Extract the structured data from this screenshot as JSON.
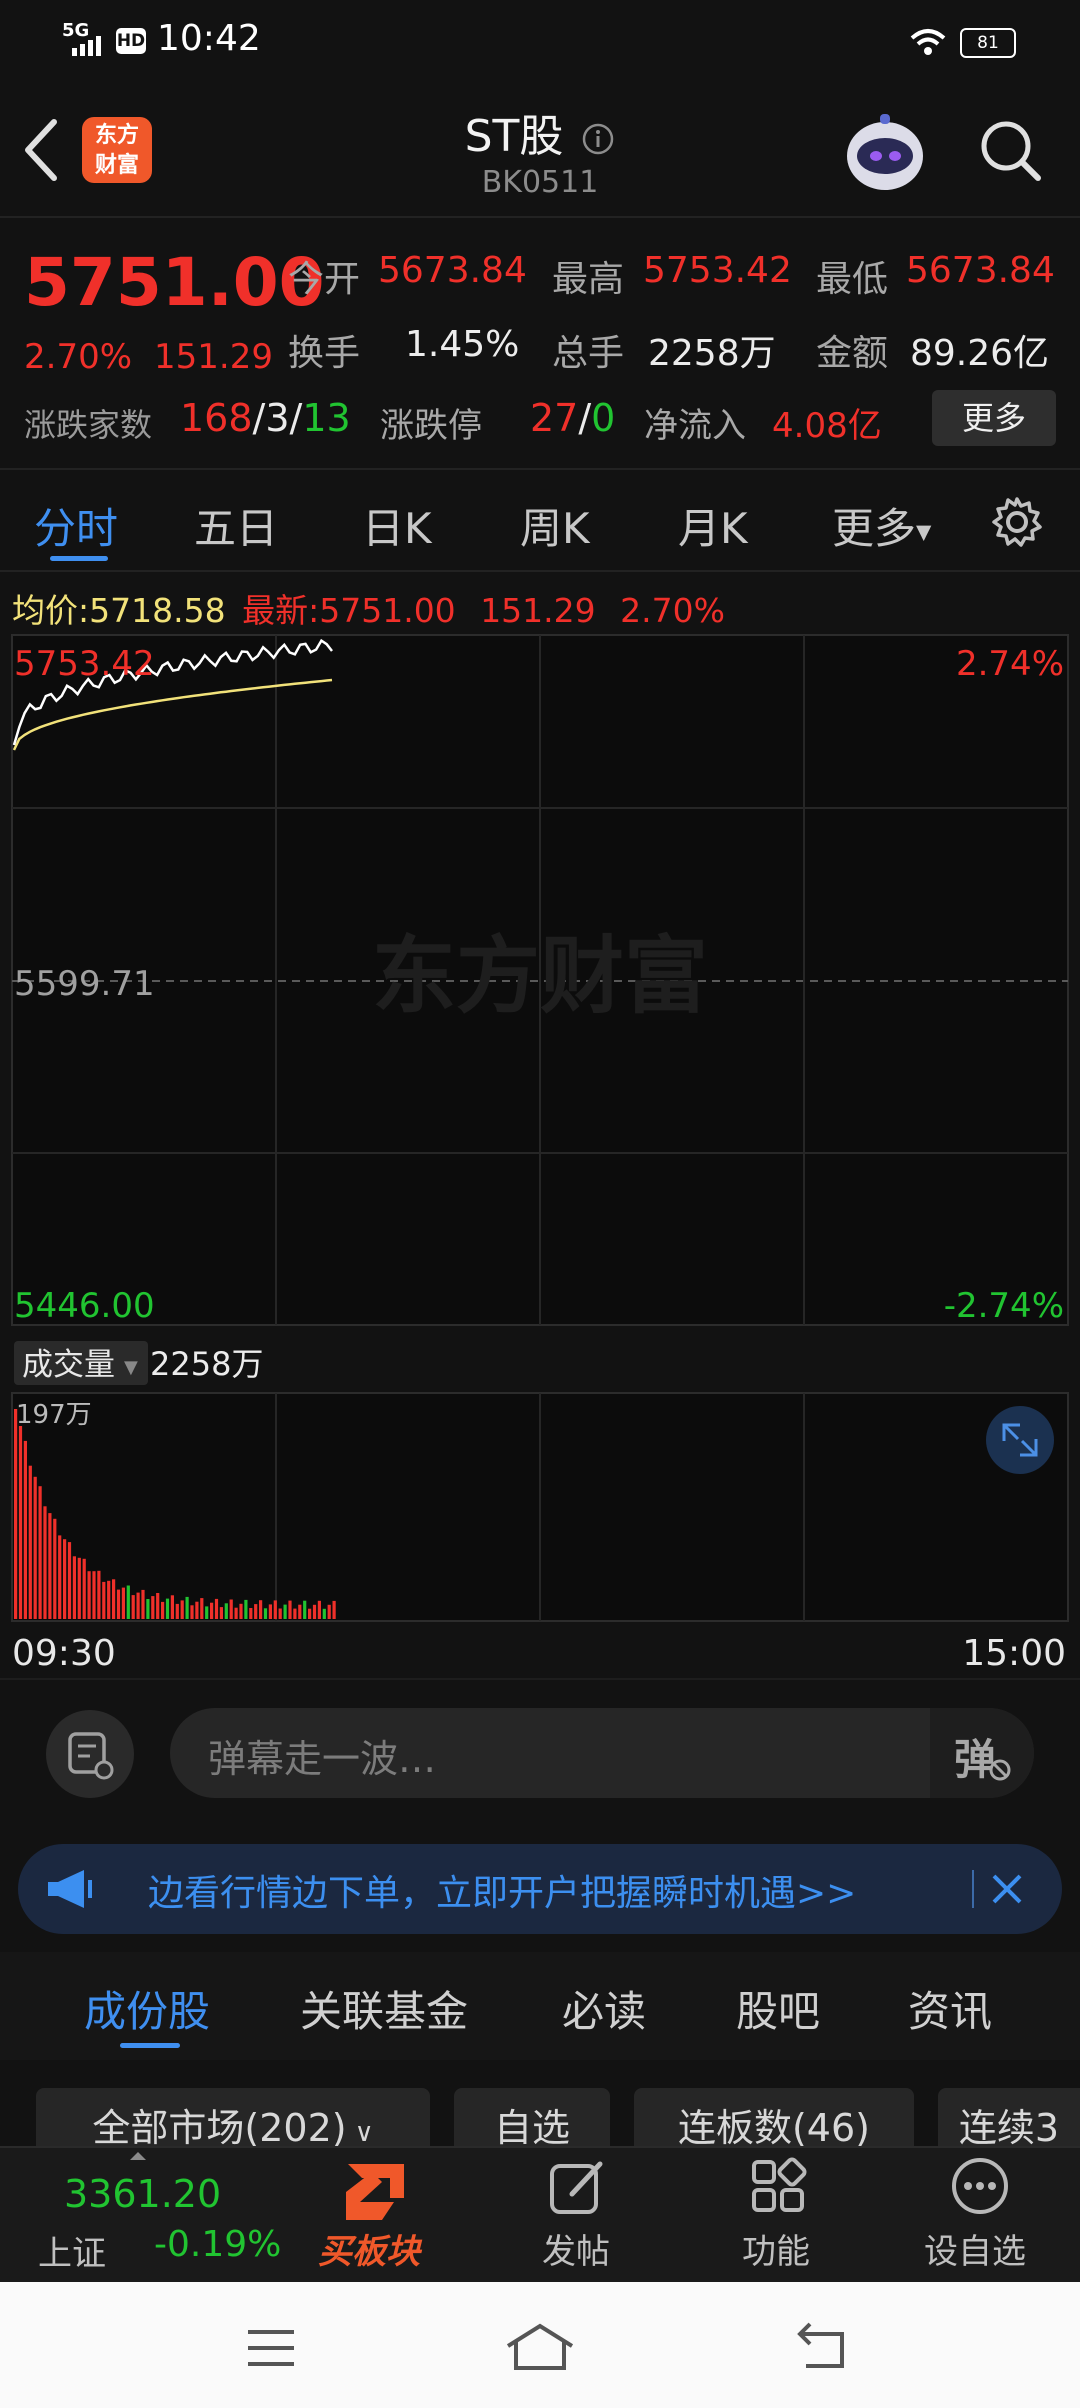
{
  "status": {
    "network": "5G",
    "hd": "HD",
    "time": "10:42",
    "battery": "81"
  },
  "header": {
    "title": "ST股",
    "code": "BK0511",
    "logo_line1": "东方",
    "logo_line2": "财富"
  },
  "quote": {
    "price": "5751.00",
    "change_pct": "2.70%",
    "change_val": "151.29",
    "open_label": "今开",
    "open": "5673.84",
    "high_label": "最高",
    "high": "5753.42",
    "low_label": "最低",
    "low": "5673.84",
    "turnover_label": "换手",
    "turnover": "1.45%",
    "volume_label": "总手",
    "volume": "2258万",
    "amount_label": "金额",
    "amount": "89.26亿",
    "breadth_label": "涨跌家数",
    "breadth_up": "168",
    "breadth_sep1": "/",
    "breadth_flat": "3",
    "breadth_sep2": "/",
    "breadth_down": "13",
    "limit_label": "涨跌停",
    "limit_up": "27",
    "limit_sep": "/",
    "limit_down": "0",
    "netflow_label": "净流入",
    "netflow": "4.08亿",
    "more_button": "更多"
  },
  "chart_tabs": [
    "分时",
    "五日",
    "日K",
    "周K",
    "月K",
    "更多"
  ],
  "chart_info": {
    "avg_label": "均价:",
    "avg_value": "5718.58",
    "latest_label": "最新:",
    "latest_value": "5751.00",
    "latest_change": "151.29",
    "latest_pct": "2.70%",
    "y_top": "5753.42",
    "y_mid": "5599.71",
    "y_bottom": "5446.00",
    "pct_top": "2.74%",
    "pct_bottom": "-2.74%",
    "watermark": "东方财富",
    "volume_label": "成交量",
    "volume_total": "2258万",
    "volume_max": "197万",
    "time_start": "09:30",
    "time_end": "15:00"
  },
  "chart_data": {
    "type": "line",
    "title": "",
    "xlabel": "",
    "ylabel": "",
    "ylim": [
      5446.0,
      5753.42
    ],
    "x_range": [
      "09:30",
      "15:00"
    ],
    "series": [],
    "volume_max": "197万",
    "volume_unit": "万"
  },
  "danmu": {
    "placeholder": "弹幕走一波…",
    "send_label": "弹"
  },
  "banner": {
    "text": "边看行情边下单，立即开户把握瞬时机遇>>"
  },
  "bottom_tabs": [
    "成份股",
    "关联基金",
    "必读",
    "股吧",
    "资讯"
  ],
  "chips": [
    "全部市场(202)",
    "自选",
    "连板数(46)",
    "连续3"
  ],
  "bottom_nav": {
    "index_value": "3361.20",
    "index_name": "上证",
    "index_change": "-0.19%",
    "buy_sector": "买板块",
    "post": "发帖",
    "functions": "功能",
    "set_favorite": "设自选"
  },
  "colors": {
    "up": "#f0302a",
    "down": "#21c431",
    "accent": "#3f8ff0",
    "avg_line": "#f2e27a",
    "price_line": "#ffffff"
  }
}
